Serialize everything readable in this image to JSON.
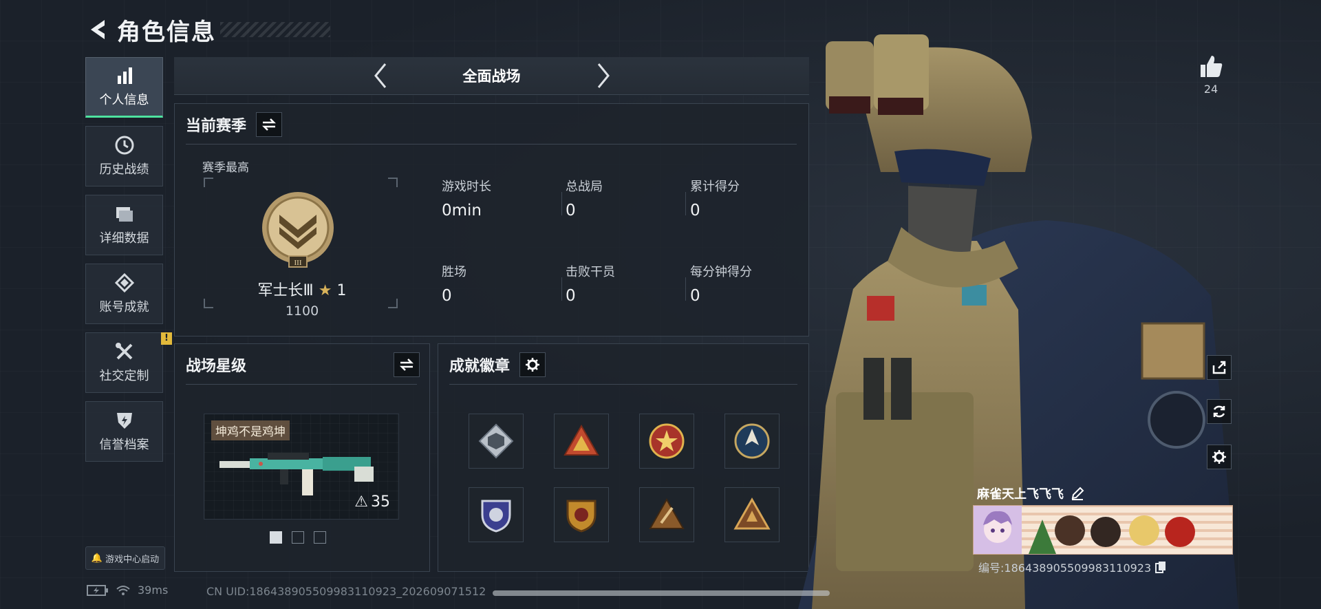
{
  "header": {
    "title": "角色信息"
  },
  "sidebar": {
    "items": [
      {
        "label": "个人信息",
        "icon": "bar-chart-icon",
        "active": true
      },
      {
        "label": "历史战绩",
        "icon": "clock-icon"
      },
      {
        "label": "详细数据",
        "icon": "folder-icon"
      },
      {
        "label": "账号成就",
        "icon": "medal-icon"
      },
      {
        "label": "社交定制",
        "icon": "tools-icon",
        "badge": "!"
      },
      {
        "label": "信誉档案",
        "icon": "shield-bolt-icon"
      }
    ],
    "launch_label": "游戏中心启动"
  },
  "mode_bar": {
    "label": "全面战场"
  },
  "season": {
    "title": "当前赛季",
    "best_label": "赛季最高",
    "rank_name": "军士长Ⅲ",
    "rank_stars": "1",
    "rank_score": "1100",
    "stats": [
      {
        "label": "游戏时长",
        "value": "0min"
      },
      {
        "label": "总战局",
        "value": "0"
      },
      {
        "label": "累计得分",
        "value": "0"
      },
      {
        "label": "胜场",
        "value": "0"
      },
      {
        "label": "击败干员",
        "value": "0"
      },
      {
        "label": "每分钟得分",
        "value": "0"
      }
    ]
  },
  "battlefield_star": {
    "title": "战场星级",
    "weapon_tag": "坤鸡不是鸡坤",
    "weapon_level": "35",
    "pages_total": 3,
    "page_active": 1
  },
  "achievements": {
    "title": "成就徽章",
    "badges": [
      "cube-badge-icon",
      "pyramid-badge-icon",
      "star-badge-icon",
      "arrow-badge-icon",
      "shield-eagle-badge-icon",
      "gold-shield-badge-icon",
      "triangle-badge-icon",
      "triangle-gold-badge-icon"
    ]
  },
  "profile": {
    "likes": "24",
    "player_name": "麻雀天上飞飞飞",
    "player_id": "编号:1864389055099831109​23",
    "player_id_text": "编号:186438905509983110923"
  },
  "footer": {
    "ping": "39ms",
    "uid": "CN UID:186438905509983110923_20260907​1512"
  },
  "colors": {
    "accent": "#4ee39f",
    "alert": "#e2b93b",
    "bg": "#1b212a"
  }
}
